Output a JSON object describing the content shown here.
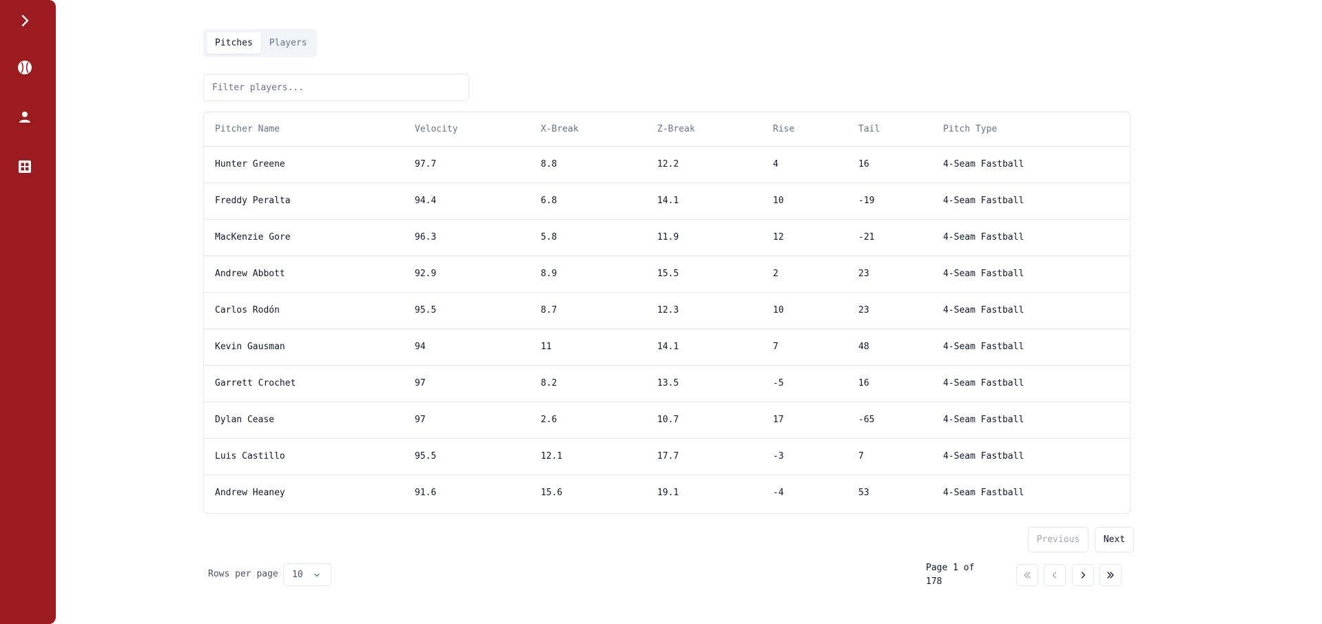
{
  "sidebar": {
    "items": [
      {
        "icon": "chevron-right-icon"
      },
      {
        "icon": "baseball-icon"
      },
      {
        "icon": "user-icon"
      },
      {
        "icon": "grid-icon"
      }
    ],
    "color": "#9b1b1e"
  },
  "tabs": [
    {
      "label": "Pitches",
      "active": true
    },
    {
      "label": "Players",
      "active": false
    }
  ],
  "filter": {
    "placeholder": "Filter players...",
    "value": ""
  },
  "table": {
    "columns": [
      "Pitcher Name",
      "Velocity",
      "X-Break",
      "Z-Break",
      "Rise",
      "Tail",
      "Pitch Type"
    ],
    "rows": [
      [
        "Hunter Greene",
        "97.7",
        "8.8",
        "12.2",
        "4",
        "16",
        "4-Seam Fastball"
      ],
      [
        "Freddy Peralta",
        "94.4",
        "6.8",
        "14.1",
        "10",
        "-19",
        "4-Seam Fastball"
      ],
      [
        "MacKenzie Gore",
        "96.3",
        "5.8",
        "11.9",
        "12",
        "-21",
        "4-Seam Fastball"
      ],
      [
        "Andrew Abbott",
        "92.9",
        "8.9",
        "15.5",
        "2",
        "23",
        "4-Seam Fastball"
      ],
      [
        "Carlos Rodón",
        "95.5",
        "8.7",
        "12.3",
        "10",
        "23",
        "4-Seam Fastball"
      ],
      [
        "Kevin Gausman",
        "94",
        "11",
        "14.1",
        "7",
        "48",
        "4-Seam Fastball"
      ],
      [
        "Garrett Crochet",
        "97",
        "8.2",
        "13.5",
        "-5",
        "16",
        "4-Seam Fastball"
      ],
      [
        "Dylan Cease",
        "97",
        "2.6",
        "10.7",
        "17",
        "-65",
        "4-Seam Fastball"
      ],
      [
        "Luis Castillo",
        "95.5",
        "12.1",
        "17.7",
        "-3",
        "7",
        "4-Seam Fastball"
      ],
      [
        "Andrew Heaney",
        "91.6",
        "15.6",
        "19.1",
        "-4",
        "53",
        "4-Seam Fastball"
      ]
    ]
  },
  "pagination": {
    "previous_label": "Previous",
    "next_label": "Next",
    "rows_per_page_label": "Rows per page",
    "rows_per_page_value": "10",
    "page_info": "Page 1 of 178"
  }
}
